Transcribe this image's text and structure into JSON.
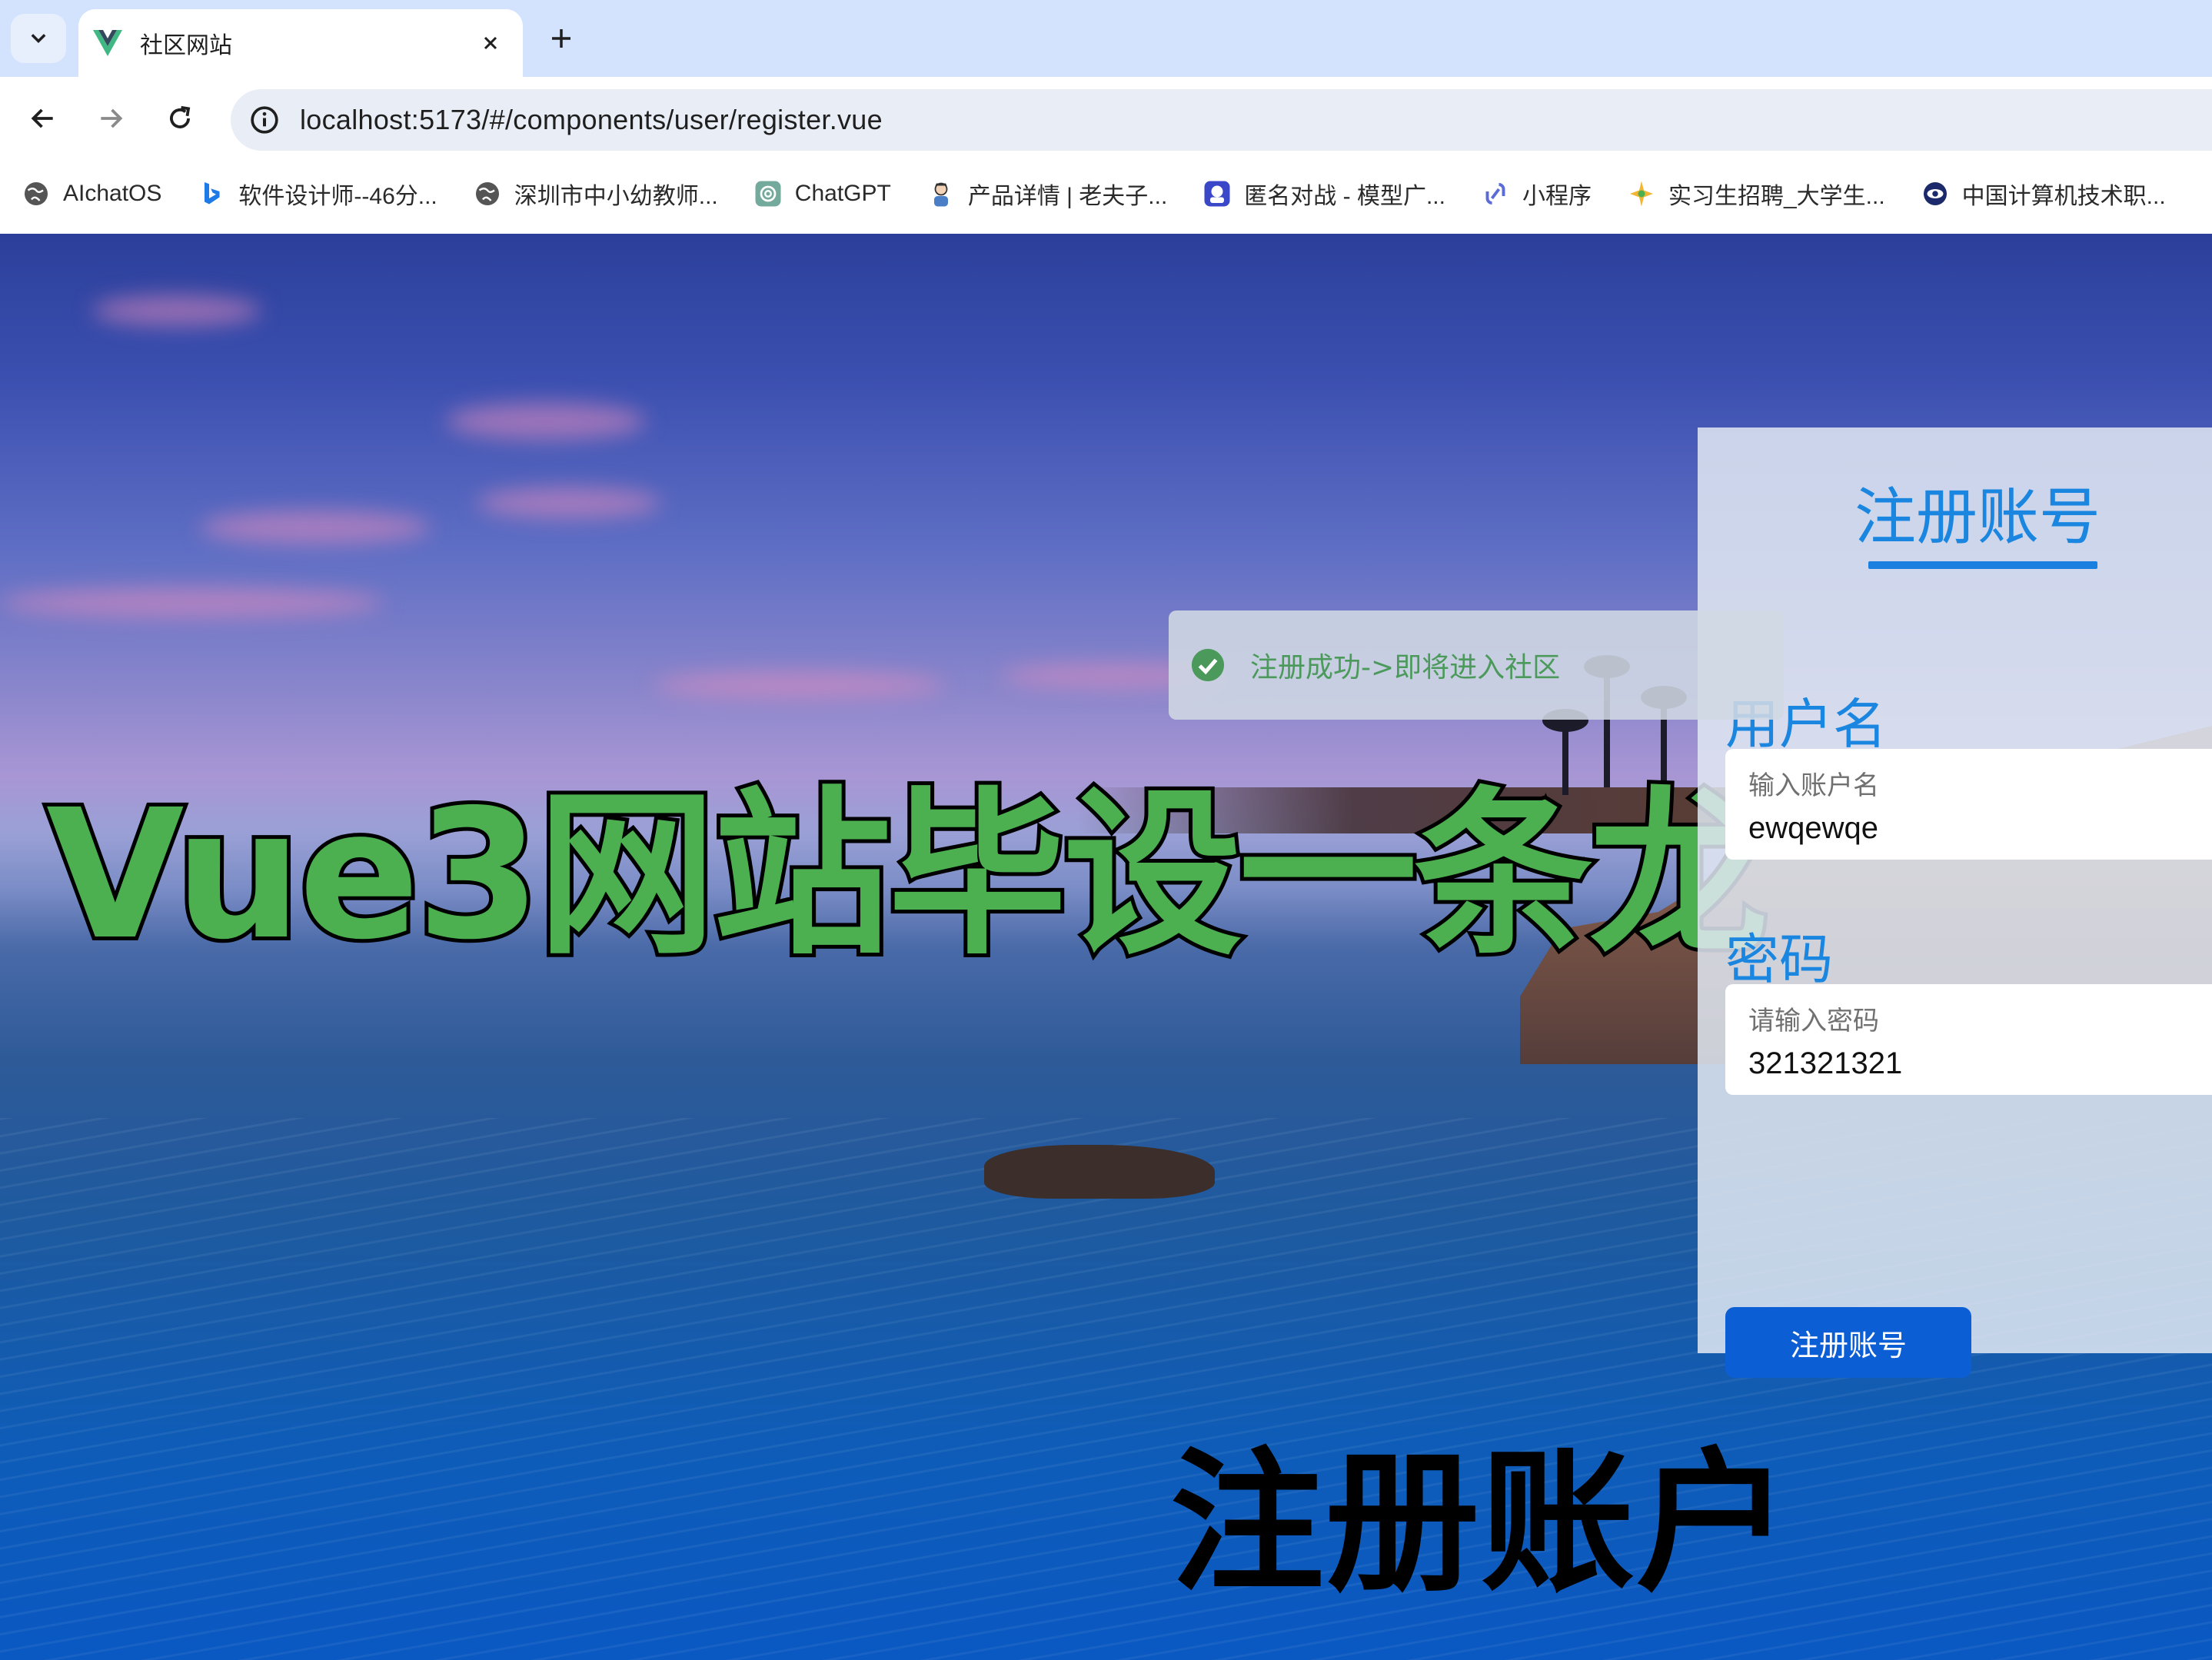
{
  "browser": {
    "tab": {
      "title": "社区网站",
      "favicon": "vue-logo-icon"
    },
    "url": "localhost:5173/#/components/user/register.vue",
    "bookmarks": [
      {
        "label": "AIchatOS",
        "icon": "globe-icon"
      },
      {
        "label": "软件设计师--46分...",
        "icon": "bing-icon"
      },
      {
        "label": "深圳市中小幼教师...",
        "icon": "globe-icon"
      },
      {
        "label": "ChatGPT",
        "icon": "openai-icon"
      },
      {
        "label": "产品详情 | 老夫子...",
        "icon": "avatar-icon"
      },
      {
        "label": "匿名对战 - 模型广...",
        "icon": "robot-icon"
      },
      {
        "label": "小程序",
        "icon": "link-icon"
      },
      {
        "label": "实习生招聘_大学生...",
        "icon": "star-icon"
      },
      {
        "label": "中国计算机技术职...",
        "icon": "eye-icon"
      }
    ]
  },
  "toast": {
    "message": "注册成功->即将进入社区",
    "status": "success"
  },
  "register": {
    "title": "注册账号",
    "username": {
      "label": "用户名",
      "placeholder": "输入账户名",
      "value": "ewqewqe"
    },
    "password": {
      "label": "密码",
      "placeholder": "请输入密码",
      "value": "321321321"
    },
    "submit_label": "注册账号"
  },
  "overlay": {
    "headline": "Vue3网站毕设一条龙",
    "subtitle": "注册账户"
  },
  "colors": {
    "accent": "#1a86e0",
    "button": "#0c5ed4",
    "success": "#4b9a5b",
    "headline": "#4caf50"
  }
}
